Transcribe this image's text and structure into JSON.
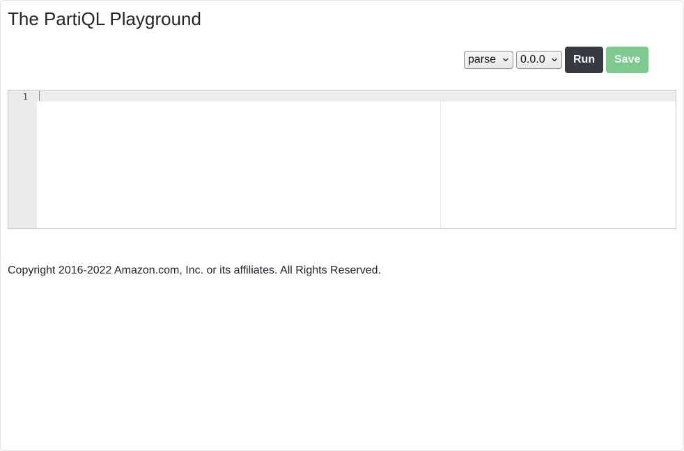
{
  "header": {
    "title": "The PartiQL Playground"
  },
  "toolbar": {
    "mode_select": {
      "selected": "parse",
      "icon": "chevron-down-icon"
    },
    "version_select": {
      "selected": "0.0.0",
      "icon": "chevron-down-icon"
    },
    "run_label": "Run",
    "save_label": "Save",
    "colors": {
      "run": "#343a40",
      "save": "#7ec98f"
    }
  },
  "editor": {
    "line_numbers": [
      "1"
    ],
    "content": ""
  },
  "footer": {
    "copyright": "Copyright 2016-2022 Amazon.com, Inc. or its affiliates. All Rights Reserved."
  }
}
